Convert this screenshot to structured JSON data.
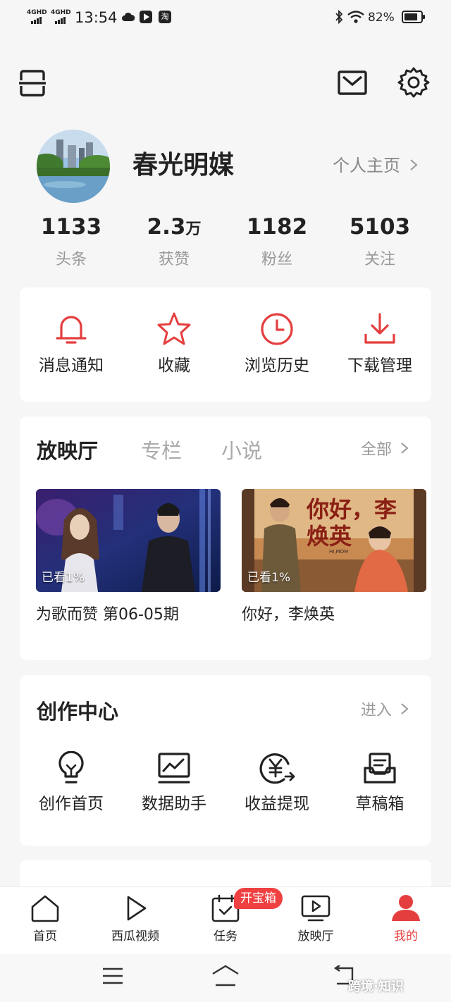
{
  "status_bar": {
    "network_1": "4GHD",
    "network_2": "4GHD",
    "time": "13:54",
    "battery_percent": "82%",
    "app_badge": "淘",
    "battery_level": 0.82
  },
  "header": {
    "scan_icon": "scan-icon",
    "mail_icon": "mail-icon",
    "settings_icon": "gear-icon"
  },
  "profile": {
    "name": "春光明媒",
    "homepage_link": "个人主页",
    "stats": [
      {
        "value": "1133",
        "unit": "",
        "label": "头条"
      },
      {
        "value": "2.3",
        "unit": "万",
        "label": "获赞"
      },
      {
        "value": "1182",
        "unit": "",
        "label": "粉丝"
      },
      {
        "value": "5103",
        "unit": "",
        "label": "关注"
      }
    ]
  },
  "quick_actions": [
    {
      "label": "消息通知",
      "icon": "bell-icon"
    },
    {
      "label": "收藏",
      "icon": "star-icon"
    },
    {
      "label": "浏览历史",
      "icon": "clock-icon"
    },
    {
      "label": "下载管理",
      "icon": "download-icon"
    }
  ],
  "media": {
    "tabs": [
      "放映厅",
      "专栏",
      "小说"
    ],
    "active_tab": "放映厅",
    "all_link": "全部",
    "items": [
      {
        "title": "为歌而赞 第06-05期",
        "progress": "已看1%"
      },
      {
        "title": "你好，李焕英",
        "progress": "已看1%",
        "poster_text": "你好，李焕英",
        "poster_sub": "HI,MOM"
      }
    ]
  },
  "creation": {
    "title": "创作中心",
    "enter_link": "进入",
    "items": [
      {
        "label": "创作首页",
        "icon": "lightbulb-icon"
      },
      {
        "label": "数据助手",
        "icon": "chart-icon"
      },
      {
        "label": "收益提现",
        "icon": "yuan-coin-icon"
      },
      {
        "label": "草稿箱",
        "icon": "draft-box-icon"
      }
    ]
  },
  "bottom_nav": {
    "items": [
      {
        "label": "首页",
        "icon": "home-icon"
      },
      {
        "label": "西瓜视频",
        "icon": "play-icon"
      },
      {
        "label": "任务",
        "icon": "task-calendar-icon"
      },
      {
        "label": "放映厅",
        "icon": "tv-play-icon"
      },
      {
        "label": "我的",
        "icon": "user-icon"
      }
    ],
    "active": "我的",
    "task_badge": "开宝箱"
  },
  "watermark": "跨境·知识",
  "colors": {
    "accent": "#e53e3e",
    "badge": "#f04142"
  }
}
